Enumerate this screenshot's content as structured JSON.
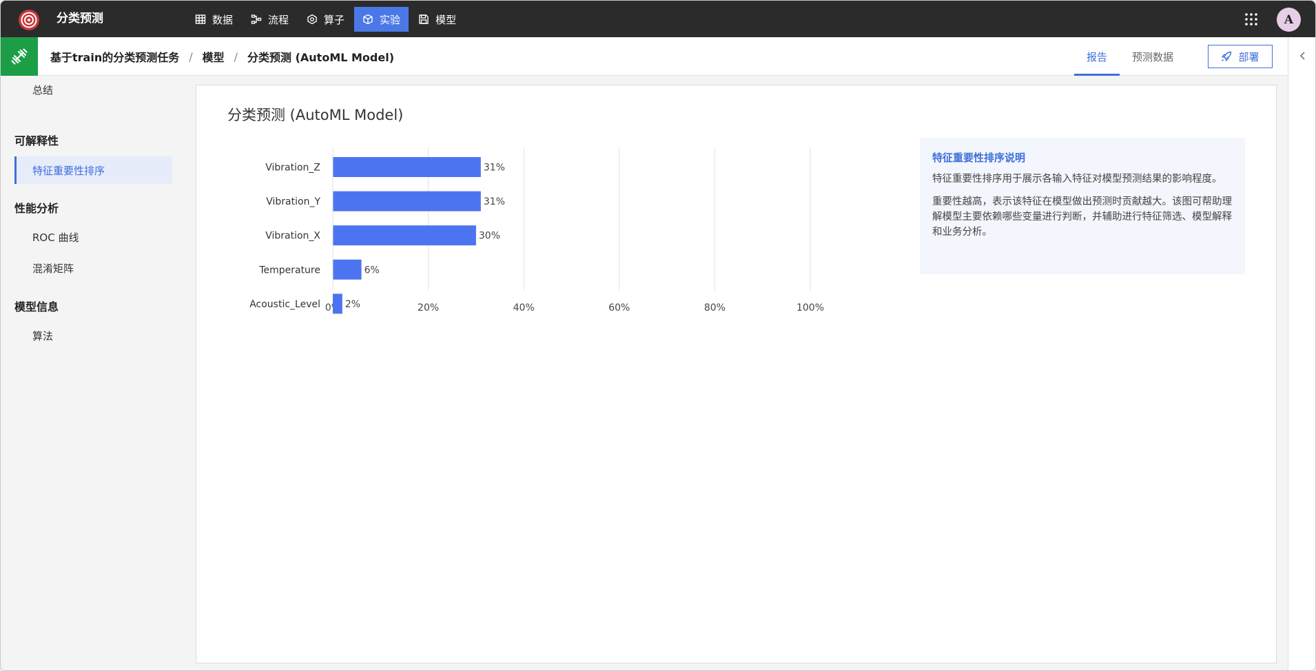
{
  "app": {
    "title": "分类预测"
  },
  "nav": [
    {
      "label": "数据",
      "icon": "table-icon",
      "active": false
    },
    {
      "label": "流程",
      "icon": "flow-icon",
      "active": false
    },
    {
      "label": "算子",
      "icon": "operator-icon",
      "active": false
    },
    {
      "label": "实验",
      "icon": "cube-icon",
      "active": true
    },
    {
      "label": "模型",
      "icon": "save-icon",
      "active": false
    }
  ],
  "user": {
    "avatar_letter": "A"
  },
  "breadcrumb": {
    "task": "基于train的分类预测任务",
    "section": "模型",
    "current": "分类预测 (AutoML Model)",
    "separator": "/"
  },
  "tabs": {
    "report": "报告",
    "prediction_data": "预测数据"
  },
  "deploy_label": "部署",
  "sidebar": {
    "summary": "总结",
    "explain_group": "可解释性",
    "feature_importance": "特征重要性排序",
    "perf_group": "性能分析",
    "roc": "ROC 曲线",
    "confusion": "混淆矩阵",
    "model_group": "模型信息",
    "algorithm": "算法"
  },
  "card": {
    "title": "分类预测 (AutoML Model)"
  },
  "info": {
    "title": "特征重要性排序说明",
    "p1": "特征重要性排序用于展示各输入特征对模型预测结果的影响程度。",
    "p2": "重要性越高，表示该特征在模型做出预测时贡献越大。该图可帮助理解模型主要依赖哪些变量进行判断，并辅助进行特征筛选、模型解释和业务分析。"
  },
  "colors": {
    "accent": "#4a78e6",
    "bar": "#4d74f0",
    "badge": "#1b9e46"
  },
  "chart_data": {
    "type": "bar",
    "orientation": "horizontal",
    "categories": [
      "Vibration_Z",
      "Vibration_Y",
      "Vibration_X",
      "Temperature",
      "Acoustic_Level"
    ],
    "values": [
      31,
      31,
      30,
      6,
      2
    ],
    "value_labels": [
      "31%",
      "31%",
      "30%",
      "6%",
      "2%"
    ],
    "xlim": [
      0,
      100
    ],
    "xticks": [
      "0%",
      "20%",
      "40%",
      "60%",
      "80%",
      "100%"
    ],
    "tick_values": [
      0,
      20,
      40,
      60,
      80,
      100
    ],
    "grid": true
  }
}
